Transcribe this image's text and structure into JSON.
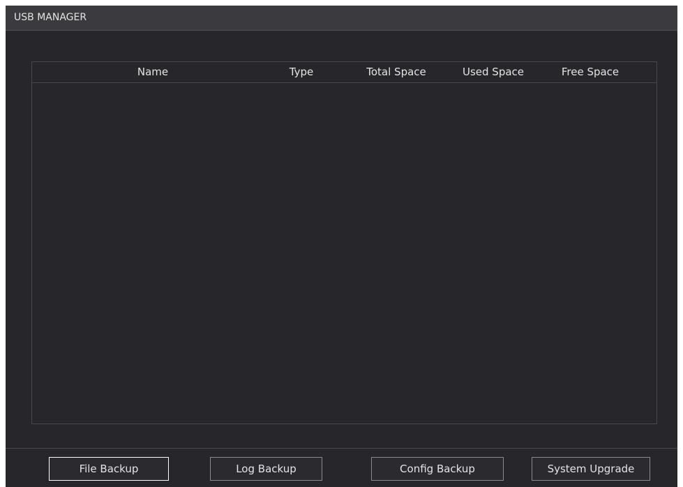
{
  "window": {
    "title": "USB MANAGER"
  },
  "table": {
    "columns": [
      "Name",
      "Type",
      "Total Space",
      "Used Space",
      "Free Space"
    ],
    "rows": []
  },
  "buttons": {
    "file_backup": "File Backup",
    "log_backup": "Log Backup",
    "config_backup": "Config Backup",
    "system_upgrade": "System Upgrade"
  }
}
